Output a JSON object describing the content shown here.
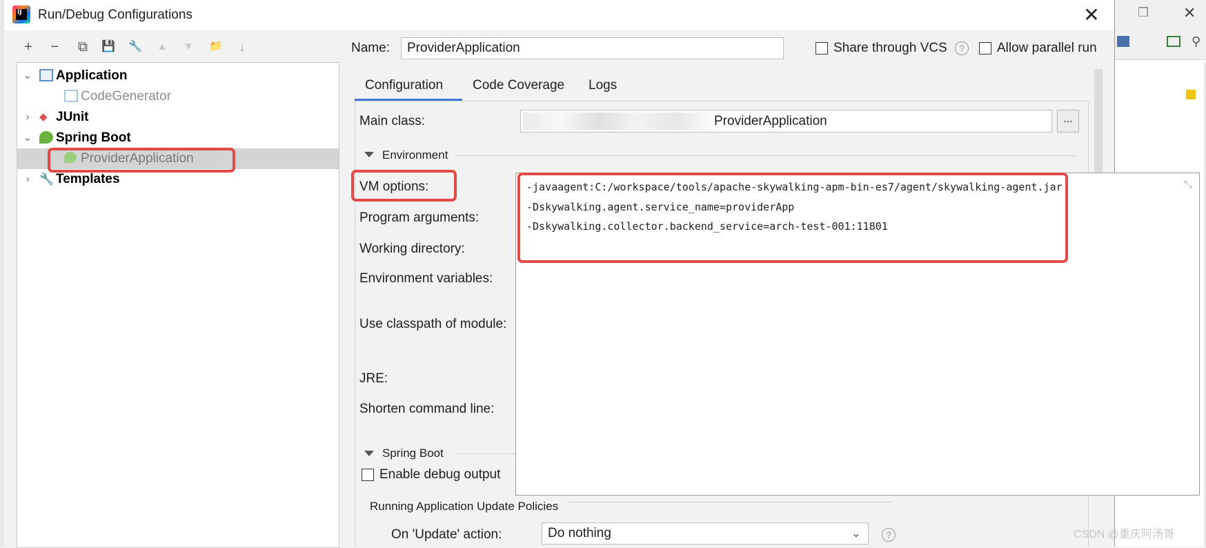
{
  "window": {
    "title": "Run/Debug Configurations",
    "close": "✕"
  },
  "toolbar": [
    "+",
    "−",
    "⧉",
    "💾",
    "🔧",
    "▲",
    "▼",
    "📁",
    "↓"
  ],
  "tree": {
    "application": "Application",
    "code_generator": "CodeGenerator",
    "junit": "JUnit",
    "spring_boot": "Spring Boot",
    "provider_application": "ProviderApplication",
    "templates": "Templates"
  },
  "form": {
    "name_label": "Name:",
    "name_value": "ProviderApplication",
    "share_vcs": "Share through VCS",
    "allow_parallel": "Allow parallel run",
    "tabs": [
      "Configuration",
      "Code Coverage",
      "Logs"
    ],
    "main_class_label": "Main class:",
    "main_class_value": "ProviderApplication",
    "browse": "...",
    "environment_section": "Environment",
    "vm_options_label": "VM options:",
    "program_arguments_label": "Program arguments:",
    "working_directory_label": "Working directory:",
    "environment_variables_label": "Environment variables:",
    "classpath_module_label": "Use classpath of module:",
    "jre_label": "JRE:",
    "shorten_cmd_label": "Shorten command line:",
    "spring_boot_section": "Spring Boot",
    "enable_debug_output": "Enable debug output",
    "update_policies_label": "Running Application Update Policies",
    "on_update_label": "On 'Update' action:",
    "on_update_value": "Do nothing"
  },
  "vm_options": [
    "-javaagent:C:/workspace/tools/apache-skywalking-apm-bin-es7/agent/skywalking-agent.jar",
    "-Dskywalking.agent.service_name=providerApp",
    "-Dskywalking.collector.backend_service=arch-test-001:11801"
  ],
  "watermark": "CSDN @重庆阿汤哥",
  "colors": {
    "highlight": "#e24a4a",
    "tab_accent": "#3d7ad6",
    "selection": "#d4d4d4"
  }
}
